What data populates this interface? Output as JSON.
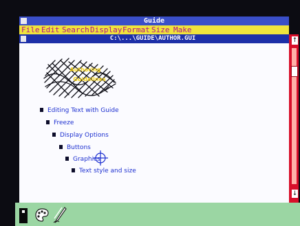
{
  "app": {
    "title": "Guide"
  },
  "menu": [
    "File",
    "Edit",
    "Search",
    "Display",
    "Format",
    "Size",
    "Make"
  ],
  "document": {
    "path": "C:\\...\\GUIDE\\AUTHOR.GUI"
  },
  "logo": {
    "line1": "Authoring",
    "line2": "Guidelines"
  },
  "outline": [
    {
      "label": "Editing Text with Guide"
    },
    {
      "label": "Freeze"
    },
    {
      "label": "Display Options"
    },
    {
      "label": "Buttons"
    },
    {
      "label": "Graphics"
    },
    {
      "label": "Text style and size"
    }
  ],
  "scrollbar": {
    "up_arrow": "↑",
    "down_arrow": "↓"
  },
  "palette": {
    "icons": [
      "pointer-tool-icon",
      "palette-icon",
      "pen-icon"
    ]
  },
  "colors": {
    "title_bar": "#3a4fc8",
    "menu_bar": "#f0e43c",
    "menu_text": "#b0128a",
    "doc_title_bar": "#1d2fa8",
    "scrollbar": "#d80f2a",
    "outline_text": "#1c2fd0",
    "palette_bg": "#9bd6a3"
  }
}
